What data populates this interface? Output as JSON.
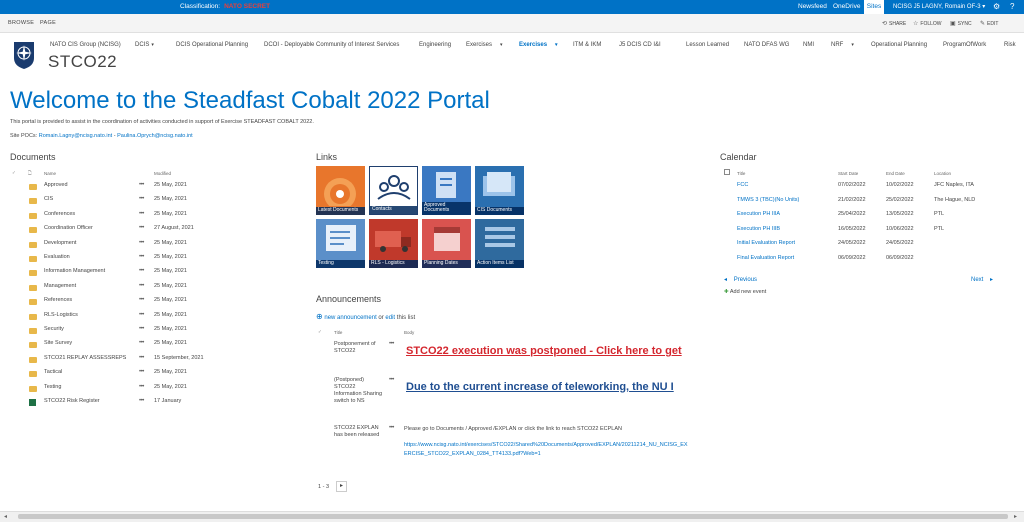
{
  "suitebar": {
    "classification_label": "Classification:",
    "classification_value": "NATO SECRET",
    "links": [
      "Newsfeed",
      "OneDrive",
      "Sites"
    ],
    "user": "NCISG J5 LAGNY, Romain OF-3",
    "accent": "#0072c6"
  },
  "ribbon": {
    "tabs": [
      "BROWSE",
      "PAGE"
    ],
    "actions": [
      "SHARE",
      "FOLLOW",
      "SYNC",
      "EDIT"
    ]
  },
  "topnav": {
    "items": [
      {
        "label": "NATO CIS Group (NCISG)"
      },
      {
        "label": "DCIS"
      },
      {
        "label": "DCIS Operational Planning"
      },
      {
        "label": "DCOI - Deployable Community of Interest Services"
      },
      {
        "label": "Engineering"
      },
      {
        "label": "Exercises"
      },
      {
        "label": "Exercises"
      },
      {
        "label": "ITM & IKM"
      },
      {
        "label": "J5 DCIS CD I&I"
      },
      {
        "label": "Lesson Learned"
      },
      {
        "label": "NATO DFAS WG"
      },
      {
        "label": "NMI"
      },
      {
        "label": "NRF"
      },
      {
        "label": "Operational Planning"
      },
      {
        "label": "ProgramOfWork"
      },
      {
        "label": "Risk"
      }
    ]
  },
  "site": {
    "title": "STCO22",
    "welcome": "Welcome to the Steadfast Cobalt 2022 Portal",
    "intro": "This portal is provided to assist in the coordination of activities conducted in support of Exercise STEADFAST COBALT 2022.",
    "pocs_label": "Site POCs:",
    "poc1": "Romain.Lagny@ncisg.nato.int",
    "poc_sep": " - ",
    "poc2": "Paulina.Oprych@ncisg.nato.int"
  },
  "documents": {
    "heading": "Documents",
    "col_name": "Name",
    "col_modified": "Modified",
    "rows": [
      {
        "name": "Approved",
        "modified": "25 May, 2021"
      },
      {
        "name": "CIS",
        "modified": "25 May, 2021"
      },
      {
        "name": "Conferences",
        "modified": "25 May, 2021"
      },
      {
        "name": "Coordination Officer",
        "modified": "27 August, 2021"
      },
      {
        "name": "Development",
        "modified": "25 May, 2021"
      },
      {
        "name": "Evaluation",
        "modified": "25 May, 2021"
      },
      {
        "name": "Information Management",
        "modified": "25 May, 2021"
      },
      {
        "name": "Management",
        "modified": "25 May, 2021"
      },
      {
        "name": "References",
        "modified": "25 May, 2021"
      },
      {
        "name": "RLS-Logistics",
        "modified": "25 May, 2021"
      },
      {
        "name": "Security",
        "modified": "25 May, 2021"
      },
      {
        "name": "Site Survey",
        "modified": "25 May, 2021"
      },
      {
        "name": "STCO21 REPLAY ASSESSREPS",
        "modified": "15 September, 2021"
      },
      {
        "name": "Tactical",
        "modified": "25 May, 2021"
      },
      {
        "name": "Testing",
        "modified": "25 May, 2021"
      },
      {
        "name": "STCO22 Risk Register",
        "modified": "17 January"
      }
    ]
  },
  "links": {
    "heading": "Links",
    "tiles": [
      {
        "label": "Latest Documents",
        "bg": "#e8762c"
      },
      {
        "label": "Contacts",
        "bg": "#1f3f6e"
      },
      {
        "label": "Approved Documents",
        "bg": "#3a78c2"
      },
      {
        "label": "CIS Documents",
        "bg": "#2a6fb0"
      },
      {
        "label": "Testing",
        "bg": "#5b8fc9"
      },
      {
        "label": "RLS - Logistics",
        "bg": "#c0392b"
      },
      {
        "label": "Planning Dates",
        "bg": "#d9534f"
      },
      {
        "label": "Action Items List",
        "bg": "#2f6a9e"
      }
    ]
  },
  "announcements": {
    "heading": "Announcements",
    "new_label": "new announcement",
    "or_label": " or ",
    "edit_label": "edit",
    "this_list": " this list",
    "col_title": "Title",
    "col_body": "Body",
    "items": [
      {
        "title": "Postponement of STCO22",
        "body": "STCO22 execution was postponed - Click here to get"
      },
      {
        "title": "(Postponed) STCO22 Information Sharing switch to NS",
        "body": "Due to the current increase of teleworking, the NU I"
      },
      {
        "title": "STCO22 EXPLAN has been released",
        "body": "Please go to Documents / Approved /EXPLAN or  click the link to reach STCO22 ECPLAN",
        "link": "https://www.ncisg.nato.int/exercises/STCO22/Shared%20Documents/Approved/EXPLAN/20211214_NU_NCISG_EXERCISE_STCO22_EXPLAN_0284_TT4133.pdf?Web=1"
      }
    ],
    "pager": "1 - 3"
  },
  "calendar": {
    "heading": "Calendar",
    "col_title": "Title",
    "col_start": "Start Date",
    "col_end": "End Date",
    "col_location": "Location",
    "events": [
      {
        "title": "FCC",
        "start": "07/02/2022",
        "end": "10/02/2022",
        "location": "JFC Naples, ITA"
      },
      {
        "title": "TMWS 3 (TBC)(No Units)",
        "start": "21/02/2022",
        "end": "25/02/2022",
        "location": "The Hague, NLD"
      },
      {
        "title": "Execution PH IIIA",
        "start": "25/04/2022",
        "end": "13/05/2022",
        "location": "PTL"
      },
      {
        "title": "Execution PH IIIB",
        "start": "16/05/2022",
        "end": "10/06/2022",
        "location": "PTL"
      },
      {
        "title": "Initial Evaluation Report",
        "start": "24/05/2022",
        "end": "24/05/2022",
        "location": ""
      },
      {
        "title": "Final Evaluation Report",
        "start": "06/09/2022",
        "end": "06/09/2022",
        "location": ""
      }
    ],
    "previous": "Previous",
    "next": "Next",
    "add": "Add new event"
  }
}
